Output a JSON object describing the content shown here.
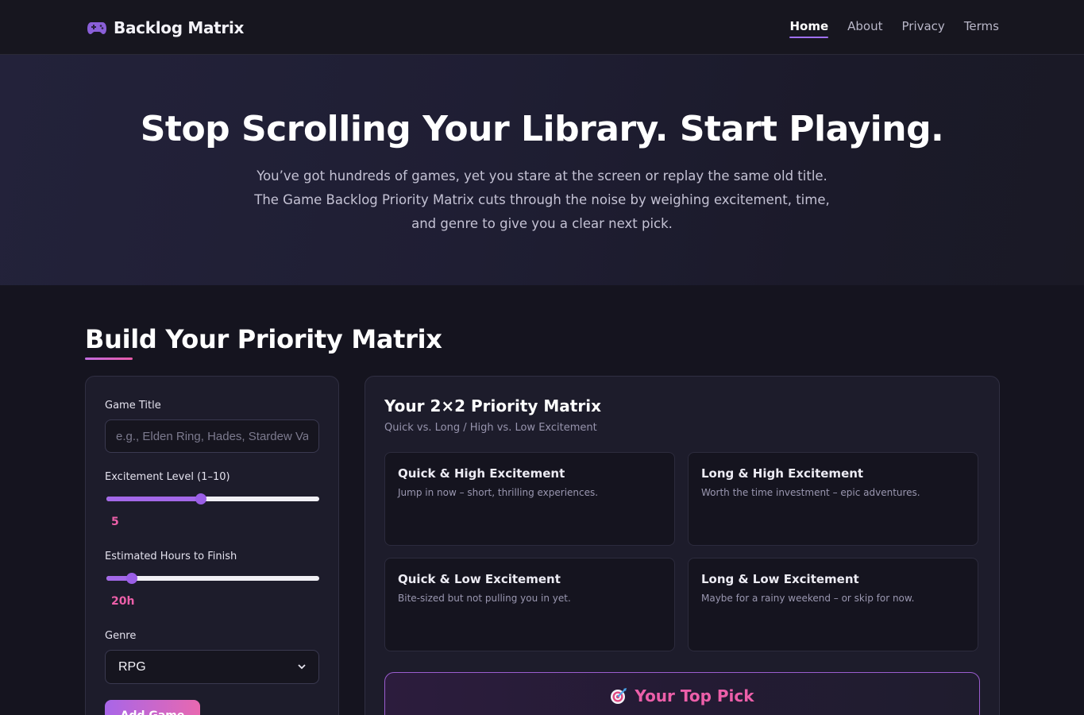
{
  "nav": {
    "brand": "Backlog Matrix",
    "brand_icon": "gamepad-icon",
    "links": [
      {
        "label": "Home",
        "active": true
      },
      {
        "label": "About",
        "active": false
      },
      {
        "label": "Privacy",
        "active": false
      },
      {
        "label": "Terms",
        "active": false
      }
    ]
  },
  "hero": {
    "title": "Stop Scrolling Your Library. Start Playing.",
    "subtitle": "You’ve got hundreds of games, yet you stare at the screen or replay the same old title. The Game Backlog Priority Matrix cuts through the noise by weighing excitement, time, and genre to give you a clear next pick."
  },
  "section": {
    "title": "Build Your Priority Matrix"
  },
  "form": {
    "game_title_label": "Game Title",
    "game_title_placeholder": "e.g., Elden Ring, Hades, Stardew Valley",
    "game_title_value": "",
    "excitement_label": "Excitement Level (1–10)",
    "excitement_value": "5",
    "excitement_fraction": 0.444,
    "hours_label": "Estimated Hours to Finish",
    "hours_value": "20h",
    "hours_fraction": 0.118,
    "genre_label": "Genre",
    "genre_value": "RPG",
    "add_button": "Add Game"
  },
  "matrix": {
    "title": "Your 2×2 Priority Matrix",
    "subtitle": "Quick vs. Long / High vs. Low Excitement",
    "quadrants": [
      {
        "title": "Quick & High Excitement",
        "desc": "Jump in now – short, thrilling experiences."
      },
      {
        "title": "Long & High Excitement",
        "desc": "Worth the time investment – epic adventures."
      },
      {
        "title": "Quick & Low Excitement",
        "desc": "Bite-sized but not pulling you in yet."
      },
      {
        "title": "Long & Low Excitement",
        "desc": "Maybe for a rainy weekend – or skip for now."
      }
    ],
    "top_pick_title": "Your Top Pick",
    "top_pick_icon": "target-icon"
  },
  "colors": {
    "accent_pink": "#ec5fa9",
    "accent_purple": "#a368e8",
    "background": "#15141f",
    "card": "#1d1c2b"
  }
}
